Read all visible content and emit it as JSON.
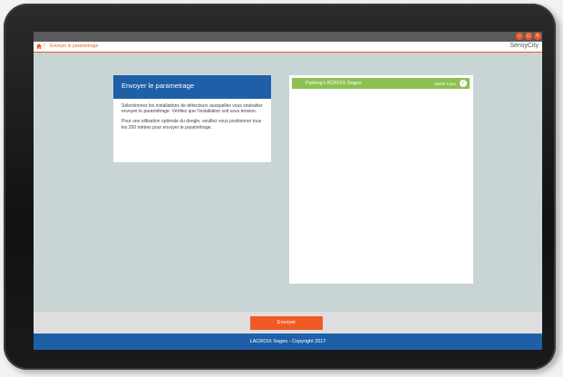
{
  "window": {
    "minimize_icon": "minimize-icon",
    "maximize_icon": "maximize-icon",
    "close_icon": "close-icon"
  },
  "appbar": {
    "home_icon": "home-icon",
    "separator": "›",
    "breadcrumb": "Envoyer le paramétrage",
    "brand": "SensyCity",
    "accent_color": "#f05a24"
  },
  "info_panel": {
    "title": "Envoyer le parametrage",
    "paragraph_1": "Sélectionnez les installations de détecteurs auxquelles vous souhaitez envoyer le paramétrage. Vérifiez que l'installation soit sous tension.",
    "paragraph_2": "Pour une utilisation optimale du dongle, veuillez vous positionner tous les 200 mètres pour envoyer le paramétrage.",
    "header_color": "#1f5fa8"
  },
  "installations": {
    "items": [
      {
        "label": "Parking LACROIX Sogeo",
        "status": "Mettre à jour",
        "selected": true,
        "color": "#8cc152"
      }
    ]
  },
  "actions": {
    "send_label": "Envoyer"
  },
  "footer": {
    "copyright": "LACROIX Sogeo - Copyright 2017"
  }
}
